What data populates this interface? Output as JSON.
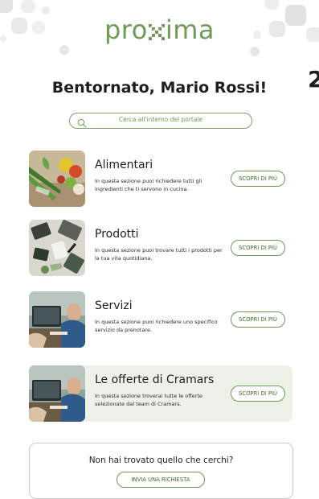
{
  "header": {
    "logo_text_left": "pro",
    "logo_text_right": "ima",
    "logo_label": "proxima",
    "side_number": "2"
  },
  "greeting": "Bentornato, Mario Rossi!",
  "search": {
    "placeholder": "Cerca all'interno del portale"
  },
  "cards": [
    {
      "title": "Alimentari",
      "description": "In questa sezione puoi richiedere tutti gli ingredienti che ti servono in cucina.",
      "button": "SCOPRI DI PIÙ",
      "image_icon": "vegetables-photo"
    },
    {
      "title": "Prodotti",
      "description": "In questa sezione puoi trovare tutti i prodotti per la tua vita quotidiana.",
      "button": "SCOPRI DI PIÙ",
      "image_icon": "office-products-photo"
    },
    {
      "title": "Servizi",
      "description": "In questa sezione puoi richiedere uno specifico servizio da prenotare.",
      "button": "SCOPRI DI PIÙ",
      "image_icon": "business-meeting-photo"
    },
    {
      "title": "Le offerte di Cramars",
      "description": "In questa sezione troverai tutte le offerte selezionate dal team di Cramars.",
      "button": "SCOPRI DI PIÙ",
      "image_icon": "business-meeting-photo"
    }
  ],
  "not_found": {
    "question": "Non hai trovato quello che cerchi?",
    "button": "INVIA UNA RICHIESTA"
  },
  "colors": {
    "brand_green": "#6f9a55",
    "button_text": "#3e6a2c",
    "highlight_bg": "#edf1ea"
  }
}
